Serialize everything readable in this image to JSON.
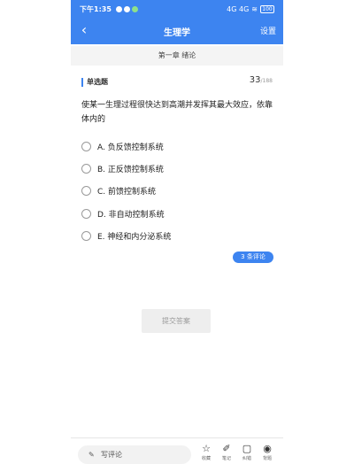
{
  "status_bar": {
    "time": "下午1:35",
    "signal": "4G 4G",
    "battery": "100"
  },
  "header": {
    "back_icon": "chevron-left-icon",
    "title": "生理学",
    "settings_label": "设置"
  },
  "chapter": "第一章 绪论",
  "question": {
    "type_label": "单选题",
    "current": "33",
    "total": "/188",
    "text": "使某一生理过程很快达到高潮并发挥其最大效应，依靠体内的",
    "options": [
      {
        "label": "A. 负反馈控制系统"
      },
      {
        "label": "B. 正反馈控制系统"
      },
      {
        "label": "C. 前馈控制系统"
      },
      {
        "label": "D. 非自动控制系统"
      },
      {
        "label": "E. 神经和内分泌系统"
      }
    ]
  },
  "comments_badge": "3 条评论",
  "submit_label": "提交答案",
  "bottom_bar": {
    "comment_placeholder": "写评论",
    "actions": [
      {
        "label": "收藏",
        "icon": "star-icon"
      },
      {
        "label": "笔记",
        "icon": "note-icon"
      },
      {
        "label": "纠错",
        "icon": "report-icon"
      },
      {
        "label": "背题",
        "icon": "eye-icon"
      }
    ]
  },
  "colors": {
    "accent": "#3d84f0",
    "submit_bg": "#eeeeee",
    "submit_text": "#9a9a9a"
  }
}
